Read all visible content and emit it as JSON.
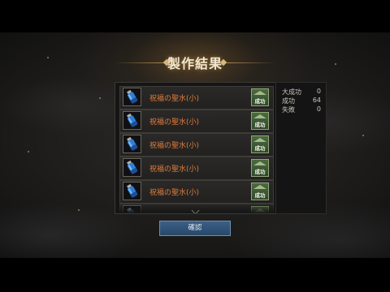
{
  "title": "製作結果",
  "results": [
    {
      "item_name": "祝福の聖水(小)",
      "result": "成功",
      "icon": "blue-potion-icon"
    },
    {
      "item_name": "祝福の聖水(小)",
      "result": "成功",
      "icon": "blue-potion-icon"
    },
    {
      "item_name": "祝福の聖水(小)",
      "result": "成功",
      "icon": "blue-potion-icon"
    },
    {
      "item_name": "祝福の聖水(小)",
      "result": "成功",
      "icon": "blue-potion-icon"
    },
    {
      "item_name": "祝福の聖水(小)",
      "result": "成功",
      "icon": "blue-potion-icon"
    },
    {
      "item_name": "",
      "result": "",
      "icon": "blue-potion-icon"
    }
  ],
  "stats": [
    {
      "label": "大成功",
      "value": "0"
    },
    {
      "label": "成功",
      "value": "64"
    },
    {
      "label": "失敗",
      "value": "0"
    }
  ],
  "confirm_label": "確認",
  "colors": {
    "item_name": "#e07d3c",
    "success_badge": "#4c6b41",
    "confirm_button": "#2f5277",
    "title_accent": "#d8b979"
  }
}
